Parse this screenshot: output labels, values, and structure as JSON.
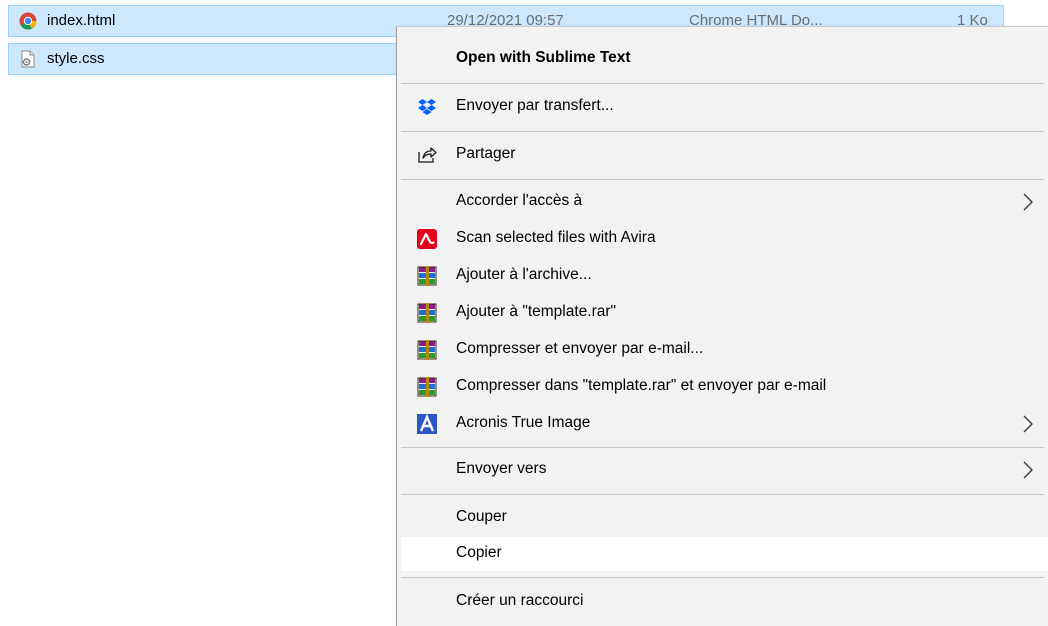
{
  "files": [
    {
      "name": "index.html",
      "date": "29/12/2021 09:57",
      "type": "Chrome HTML Do...",
      "size": "1 Ko",
      "icon": "chrome-icon"
    },
    {
      "name": "style.css",
      "icon": "css-file-icon"
    }
  ],
  "context_menu": {
    "items": {
      "open_with_sublime": "Open with Sublime Text",
      "send_transfer": "Envoyer par transfert...",
      "share": "Partager",
      "grant_access": "Accorder l'accès à",
      "scan_avira": "Scan selected files with Avira",
      "add_archive": "Ajouter à l'archive...",
      "add_template_rar": "Ajouter à \"template.rar\"",
      "compress_email": "Compresser et envoyer par e-mail...",
      "compress_template_email": "Compresser dans \"template.rar\" et envoyer par e-mail",
      "acronis": "Acronis True Image",
      "send_to": "Envoyer vers",
      "cut": "Couper",
      "copy": "Copier",
      "create_shortcut": "Créer un raccourci"
    },
    "icons": {
      "send_transfer": "dropbox-icon",
      "share": "share-icon",
      "scan_avira": "avira-icon",
      "winrar": "winrar-icon",
      "acronis": "acronis-icon",
      "submenu": "chevron-right-icon"
    }
  },
  "colors": {
    "selection_bg": "#cce8ff",
    "selection_border": "#99d1ff",
    "menu_bg": "#f2f2f2",
    "menu_hover": "#ffffff",
    "dropbox_blue": "#0061fe",
    "avira_red": "#e2001a",
    "acronis_blue": "#2a57c6"
  }
}
